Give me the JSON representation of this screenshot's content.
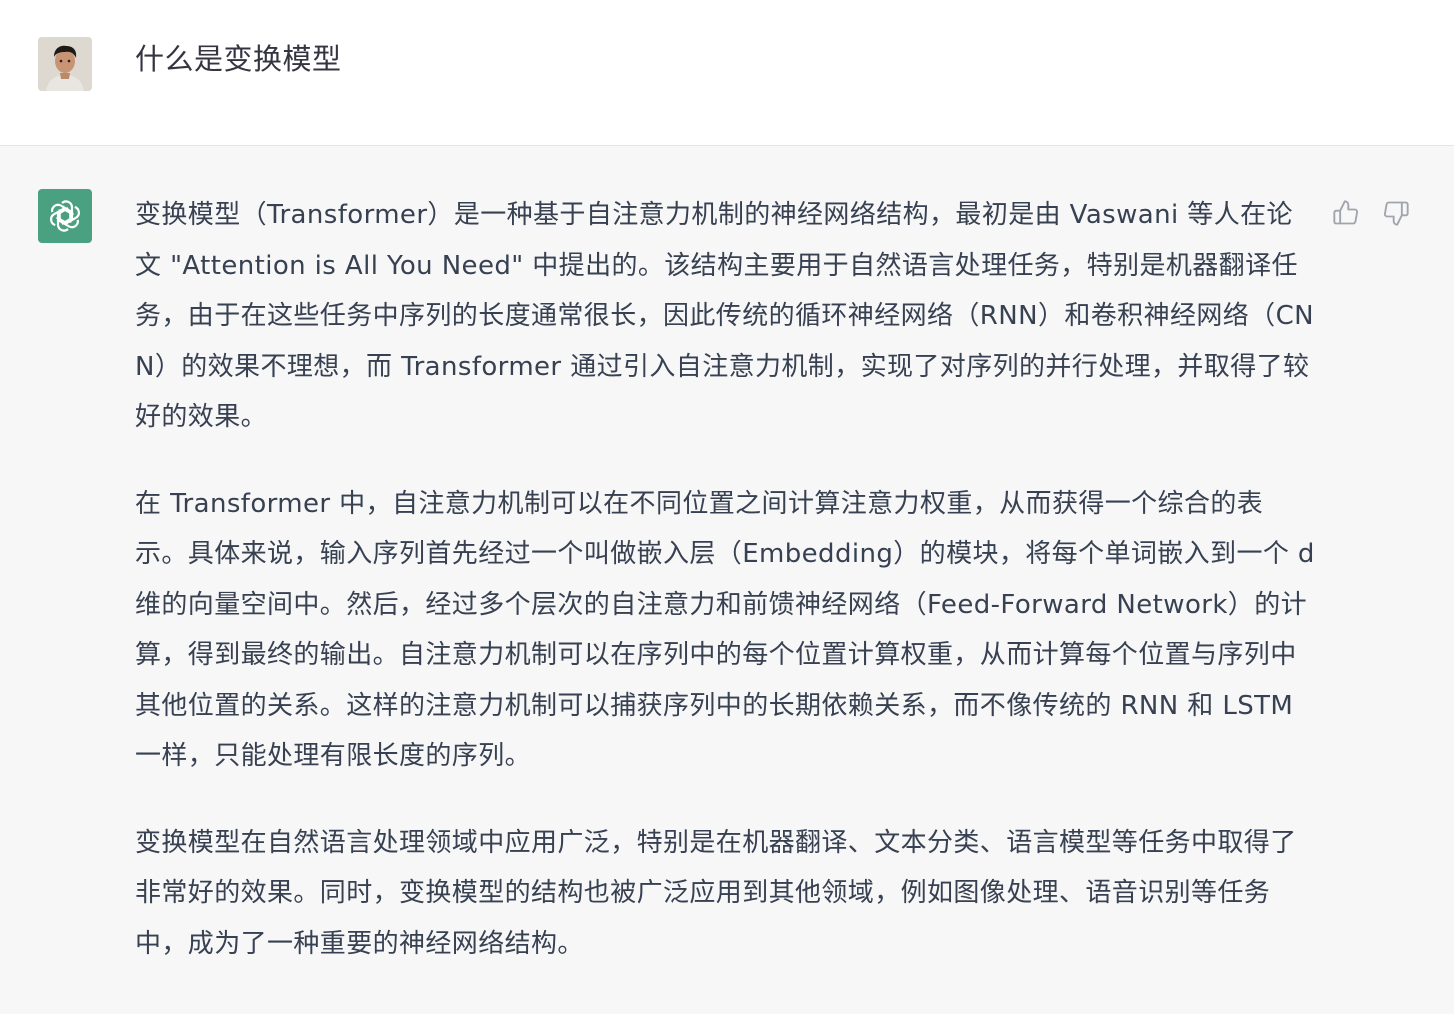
{
  "user_message": {
    "text": "什么是变换模型"
  },
  "assistant_message": {
    "paragraphs": [
      "变换模型（Transformer）是一种基于自注意力机制的神经网络结构，最初是由 Vaswani 等人在论文 \"Attention is All You Need\" 中提出的。该结构主要用于自然语言处理任务，特别是机器翻译任务，由于在这些任务中序列的长度通常很长，因此传统的循环神经网络（RNN）和卷积神经网络（CNN）的效果不理想，而 Transformer 通过引入自注意力机制，实现了对序列的并行处理，并取得了较好的效果。",
      "在 Transformer 中，自注意力机制可以在不同位置之间计算注意力权重，从而获得一个综合的表示。具体来说，输入序列首先经过一个叫做嵌入层（Embedding）的模块，将每个单词嵌入到一个 d 维的向量空间中。然后，经过多个层次的自注意力和前馈神经网络（Feed-Forward Network）的计算，得到最终的输出。自注意力机制可以在序列中的每个位置计算权重，从而计算每个位置与序列中其他位置的关系。这样的注意力机制可以捕获序列中的长期依赖关系，而不像传统的 RNN 和 LSTM 一样，只能处理有限长度的序列。",
      "变换模型在自然语言处理领域中应用广泛，特别是在机器翻译、文本分类、语言模型等任务中取得了非常好的效果。同时，变换模型的结构也被广泛应用到其他领域，例如图像处理、语音识别等任务中，成为了一种重要的神经网络结构。"
    ]
  },
  "icons": {
    "user_avatar": "user-avatar",
    "bot_avatar": "openai-logo-icon",
    "thumb_up": "thumbs-up-icon",
    "thumb_down": "thumbs-down-icon"
  },
  "colors": {
    "bot_avatar_bg": "#4aa181",
    "icon_gray": "#a0a4ad"
  }
}
